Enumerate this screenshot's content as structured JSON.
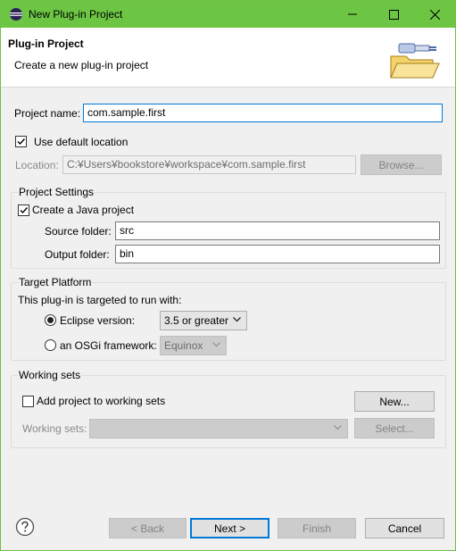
{
  "window": {
    "title": "New Plug-in Project",
    "controls": {
      "minimize": "minimize-icon",
      "maximize": "maximize-icon",
      "close": "close-icon"
    }
  },
  "header": {
    "title": "Plug-in Project",
    "subtitle": "Create a new plug-in project",
    "banner_icon": "plugin-folder-icon"
  },
  "project_name": {
    "label": "Project name:",
    "value": "com.sample.first"
  },
  "location": {
    "use_default_label": "Use default location",
    "use_default_checked": true,
    "label": "Location:",
    "value": "C:¥Users¥bookstore¥workspace¥com.sample.first",
    "browse_label": "Browse..."
  },
  "project_settings": {
    "title": "Project Settings",
    "java_label": "Create a Java project",
    "java_checked": true,
    "source_label": "Source folder:",
    "source_value": "src",
    "output_label": "Output folder:",
    "output_value": "bin"
  },
  "target_platform": {
    "title": "Target Platform",
    "intro": "This plug-in is targeted to run with:",
    "eclipse_label": "Eclipse version:",
    "eclipse_value": "3.5 or greater",
    "eclipse_selected": true,
    "osgi_label": "an OSGi framework:",
    "osgi_value": "Equinox"
  },
  "working_sets": {
    "title": "Working sets",
    "add_label": "Add project to working sets",
    "add_checked": false,
    "new_label": "New...",
    "sets_label": "Working sets:",
    "select_label": "Select..."
  },
  "footer": {
    "help_icon": "help-icon",
    "back_label": "< Back",
    "next_label": "Next >",
    "finish_label": "Finish",
    "cancel_label": "Cancel"
  },
  "colors": {
    "titlebar": "#6cc644",
    "focus": "#0078d7"
  }
}
